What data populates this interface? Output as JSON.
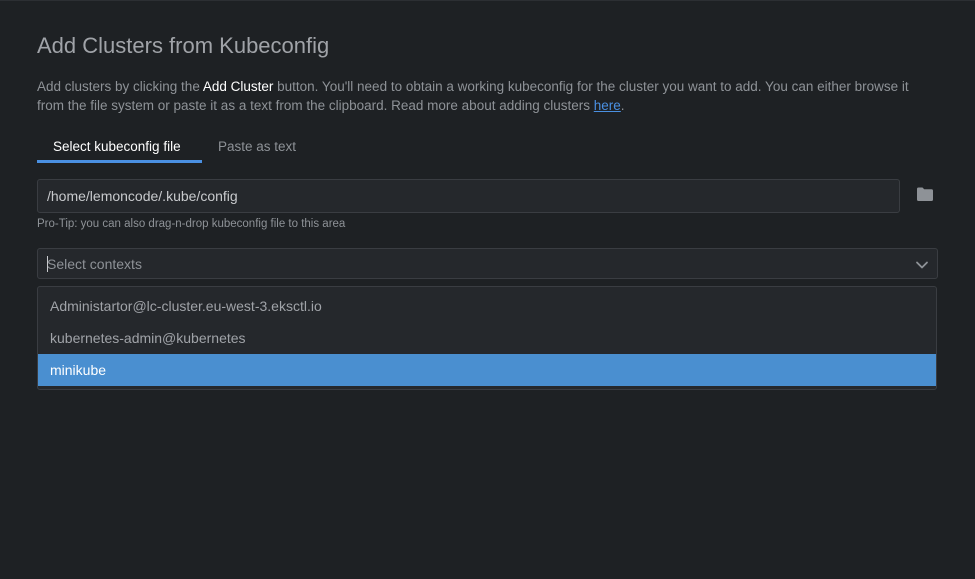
{
  "page": {
    "title": "Add Clusters from Kubeconfig",
    "description": {
      "part1": "Add clusters by clicking the ",
      "strong": "Add Cluster",
      "part2": " button. You'll need to obtain a working kubeconfig for the cluster you want to add. You can either browse it from the file system or paste it as a text from the clipboard. Read more about adding clusters ",
      "link": "here",
      "part3": "."
    }
  },
  "tabs": [
    {
      "label": "Select kubeconfig file",
      "active": true
    },
    {
      "label": "Paste as text",
      "active": false
    }
  ],
  "file_input": {
    "value": "/home/lemoncode/.kube/config",
    "tip": "Pro-Tip: you can also drag-n-drop kubeconfig file to this area"
  },
  "contexts_select": {
    "placeholder": "Select contexts",
    "options": [
      {
        "label": "Administartor@lc-cluster.eu-west-3.eksctl.io",
        "highlighted": false
      },
      {
        "label": "kubernetes-admin@kubernetes",
        "highlighted": false
      },
      {
        "label": "minikube",
        "highlighted": true
      }
    ]
  },
  "icons": {
    "browse": "folder-icon",
    "dropdown": "chevron-down-icon"
  },
  "colors": {
    "background": "#1e2124",
    "accent": "#4a90e2",
    "highlight": "#4a8fd0"
  }
}
